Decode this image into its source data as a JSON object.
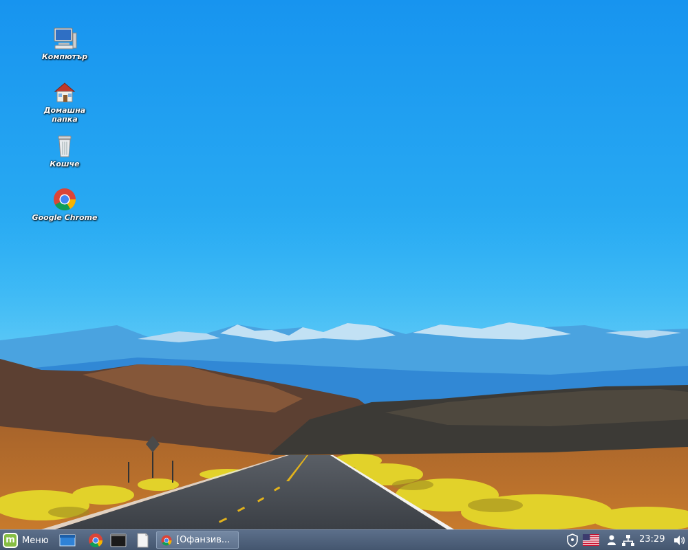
{
  "desktop": {
    "icons": [
      {
        "label": "Компютър",
        "icon": "computer-icon"
      },
      {
        "label": "Домашна\nпапка",
        "icon": "home-folder-icon"
      },
      {
        "label": "Кошче",
        "icon": "trash-icon"
      },
      {
        "label": "Google Chrome",
        "icon": "chrome-icon"
      }
    ]
  },
  "taskbar": {
    "menu_label": "Меню",
    "launchers": [
      "show-desktop-icon",
      "chrome-icon",
      "terminal-icon",
      "files-icon"
    ],
    "window_button_label": "[Офанзив...",
    "tray": [
      "shield-icon",
      "us-flag-icon",
      "user-icon",
      "network-icon",
      "volume-icon"
    ],
    "clock": "23:29"
  },
  "colors": {
    "sky_top": "#1a9ef0",
    "sky_bottom": "#48c2f2",
    "taskbar": "#4f627c",
    "mint_green": "#86be43"
  }
}
